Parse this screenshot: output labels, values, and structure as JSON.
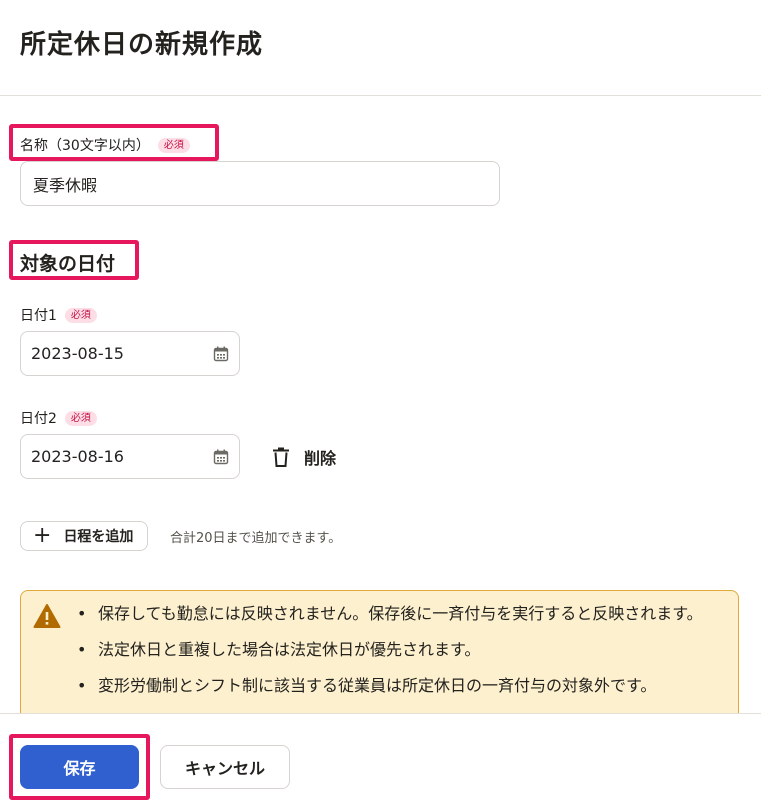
{
  "page": {
    "title": "所定休日の新規作成"
  },
  "form": {
    "name_label": "名称（30文字以内）",
    "required_badge": "必須",
    "name_value": "夏季休暇",
    "dates_section_title": "対象の日付",
    "dates": [
      {
        "label": "日付1",
        "value": "2023-08-15"
      },
      {
        "label": "日付2",
        "value": "2023-08-16"
      }
    ],
    "delete_label": "削除",
    "add_schedule_label": "日程を追加",
    "add_schedule_note": "合計20日まで追加できます。"
  },
  "alert": {
    "items": [
      "保存しても勤怠には反映されません。保存後に一斉付与を実行すると反映されます。",
      "法定休日と重複した場合は法定休日が優先されます。",
      "変形労働制とシフト制に該当する従業員は所定休日の一斉付与の対象外です。"
    ]
  },
  "footer": {
    "save_label": "保存",
    "cancel_label": "キャンセル"
  },
  "colors": {
    "primary": "#3060cf",
    "highlight": "#e6175c",
    "alert_bg": "#fdf0cf",
    "alert_border": "#e0a93a",
    "warning_icon": "#b26b00",
    "required_badge_bg": "#fddde6"
  },
  "icons": {
    "calendar": "calendar-icon",
    "trash": "trash-icon",
    "warning": "warning-icon",
    "plus": "plus-icon"
  }
}
